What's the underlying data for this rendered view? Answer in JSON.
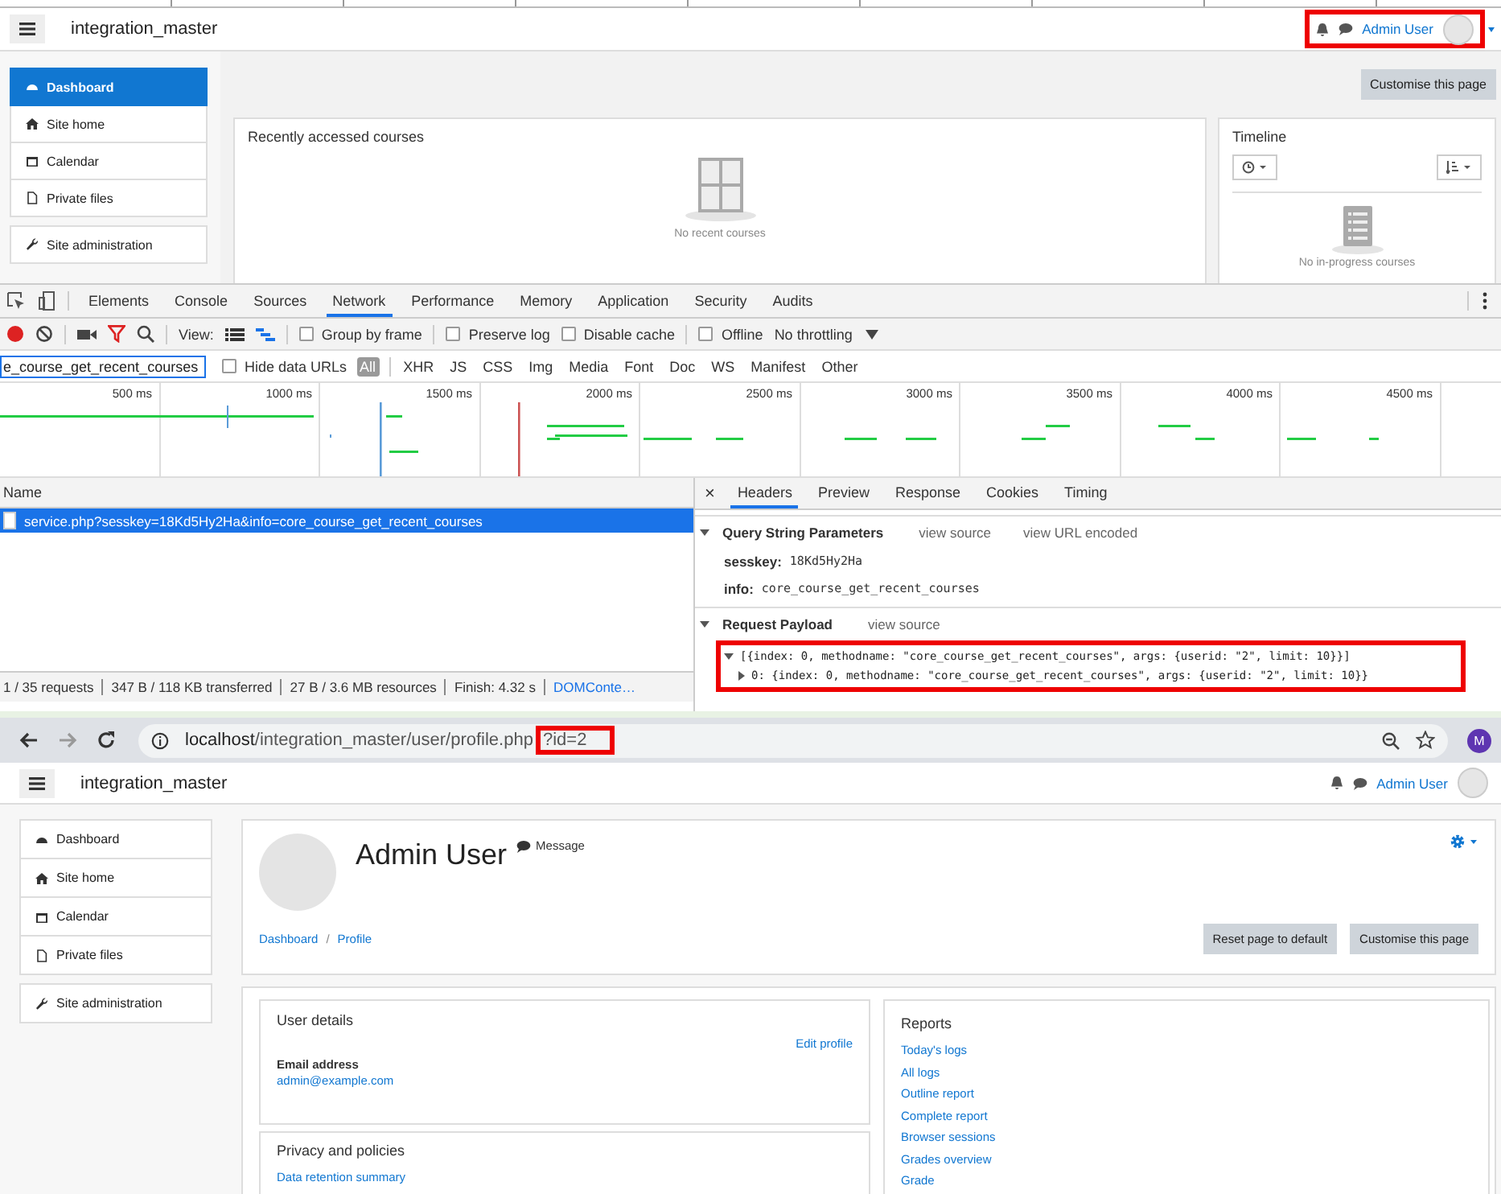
{
  "dashboard": {
    "site_name": "integration_master",
    "user_name": "Admin User",
    "nav": [
      {
        "label": "Dashboard",
        "selected": true
      },
      {
        "label": "Site home",
        "selected": false
      },
      {
        "label": "Calendar",
        "selected": false
      },
      {
        "label": "Private files",
        "selected": false
      },
      {
        "label": "Site administration",
        "selected": false
      }
    ],
    "customise_button": "Customise this page",
    "recent_courses": {
      "title": "Recently accessed courses",
      "empty": "No recent courses"
    },
    "timeline": {
      "title": "Timeline",
      "empty": "No in-progress courses"
    }
  },
  "devtools": {
    "tabs": [
      {
        "label": "Elements",
        "selected": false
      },
      {
        "label": "Console",
        "selected": false
      },
      {
        "label": "Sources",
        "selected": false
      },
      {
        "label": "Network",
        "selected": true
      },
      {
        "label": "Performance",
        "selected": false
      },
      {
        "label": "Memory",
        "selected": false
      },
      {
        "label": "Application",
        "selected": false
      },
      {
        "label": "Security",
        "selected": false
      },
      {
        "label": "Audits",
        "selected": false
      }
    ],
    "toolbar": {
      "view_label": "View:",
      "options": [
        {
          "label": "Group by frame",
          "checked": false
        },
        {
          "label": "Preserve log",
          "checked": false
        },
        {
          "label": "Disable cache",
          "checked": false
        },
        {
          "label": "Offline",
          "checked": false
        }
      ],
      "throttling": "No throttling"
    },
    "filter": {
      "value": "e_course_get_recent_courses",
      "hide_data_urls": {
        "label": "Hide data URLs",
        "checked": false
      },
      "types": [
        {
          "label": "All",
          "selected": true
        },
        {
          "label": "XHR",
          "selected": false
        },
        {
          "label": "JS",
          "selected": false
        },
        {
          "label": "CSS",
          "selected": false
        },
        {
          "label": "Img",
          "selected": false
        },
        {
          "label": "Media",
          "selected": false
        },
        {
          "label": "Font",
          "selected": false
        },
        {
          "label": "Doc",
          "selected": false
        },
        {
          "label": "WS",
          "selected": false
        },
        {
          "label": "Manifest",
          "selected": false
        },
        {
          "label": "Other",
          "selected": false
        }
      ]
    },
    "timeline_ticks": [
      "500 ms",
      "1000 ms",
      "1500 ms",
      "2000 ms",
      "2500 ms",
      "3000 ms",
      "3500 ms",
      "4000 ms",
      "4500 ms"
    ],
    "requests": {
      "column": "Name",
      "rows": [
        {
          "name": "service.php?sesskey=18Kd5Hy2Ha&info=core_course_get_recent_courses",
          "selected": true
        }
      ]
    },
    "close_label": "×",
    "detail_tabs": [
      {
        "label": "Headers",
        "selected": true
      },
      {
        "label": "Preview",
        "selected": false
      },
      {
        "label": "Response",
        "selected": false
      },
      {
        "label": "Cookies",
        "selected": false
      },
      {
        "label": "Timing",
        "selected": false
      }
    ],
    "query_params": {
      "title": "Query String Parameters",
      "links": [
        "view source",
        "view URL encoded"
      ],
      "params": [
        {
          "key": "sesskey:",
          "value": "18Kd5Hy2Ha"
        },
        {
          "key": "info:",
          "value": "core_course_get_recent_courses"
        }
      ]
    },
    "payload": {
      "title": "Request Payload",
      "link": "view source",
      "lines": [
        {
          "text": "[{index: 0, methodname: \"core_course_get_recent_courses\", args: {userid: \"2\", limit: 10}}]",
          "expanded": true
        },
        {
          "text": "0: {index: 0, methodname: \"core_course_get_recent_courses\", args: {userid: \"2\", limit: 10}}",
          "expanded": false
        }
      ]
    },
    "status": [
      {
        "text": "1 / 35 requests",
        "kind": "text"
      },
      {
        "text": "347 B / 118 KB transferred",
        "kind": "text"
      },
      {
        "text": "27 B / 3.6 MB resources",
        "kind": "text"
      },
      {
        "text": "Finish: 4.32 s",
        "kind": "text"
      },
      {
        "text": "DOMConte…",
        "kind": "link"
      }
    ]
  },
  "browser": {
    "url_host": "localhost",
    "url_path": "/integration_master/user/profile.php",
    "url_query": "?id=2",
    "profile_initial": "M"
  },
  "profile": {
    "site_name": "integration_master",
    "user_name": "Admin User",
    "nav": [
      {
        "label": "Dashboard",
        "selected": false
      },
      {
        "label": "Site home",
        "selected": false
      },
      {
        "label": "Calendar",
        "selected": false
      },
      {
        "label": "Private files",
        "selected": false
      },
      {
        "label": "Site administration",
        "selected": false
      }
    ],
    "name": "Admin User",
    "message": "Message",
    "breadcrumb": [
      "Dashboard",
      "Profile"
    ],
    "breadcrumb_separator": "/",
    "buttons": [
      "Reset page to default",
      "Customise this page"
    ],
    "user_details": {
      "title": "User details",
      "edit": "Edit profile",
      "email_label": "Email address",
      "email": "admin@example.com"
    },
    "privacy": {
      "title": "Privacy and policies",
      "link": "Data retention summary"
    },
    "reports": {
      "title": "Reports",
      "links": [
        "Today's logs",
        "All logs",
        "Outline report",
        "Complete report",
        "Browser sessions",
        "Grades overview",
        "Grade"
      ]
    }
  }
}
